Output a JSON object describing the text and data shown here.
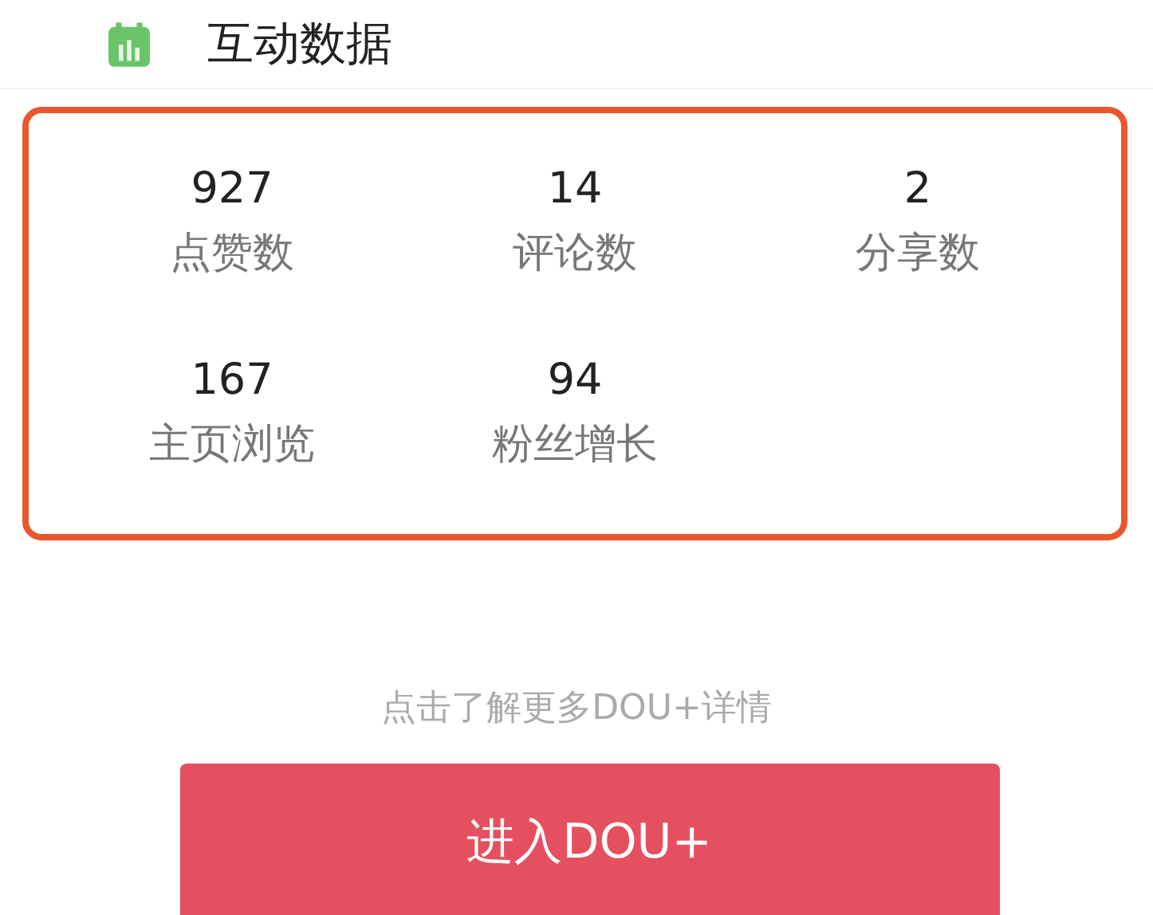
{
  "section": {
    "title": "互动数据"
  },
  "stats": [
    {
      "value": "927",
      "label": "点赞数"
    },
    {
      "value": "14",
      "label": "评论数"
    },
    {
      "value": "2",
      "label": "分享数"
    },
    {
      "value": "167",
      "label": "主页浏览"
    },
    {
      "value": "94",
      "label": "粉丝增长"
    }
  ],
  "hint": "点击了解更多DOU+详情",
  "button": "进入DOU+"
}
